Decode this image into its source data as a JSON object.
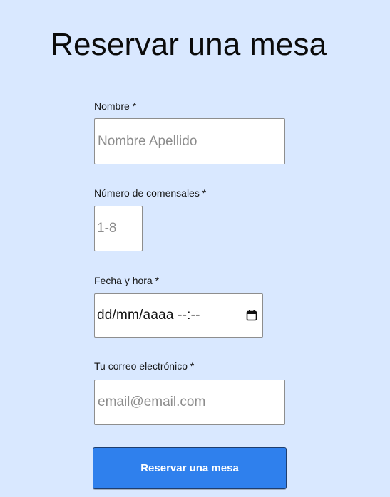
{
  "page": {
    "title": "Reservar una mesa"
  },
  "form": {
    "name": {
      "label": "Nombre *",
      "placeholder": "Nombre Apellido"
    },
    "guests": {
      "label": "Número de comensales *",
      "placeholder": "1-8"
    },
    "datetime": {
      "label": "Fecha y hora *",
      "display": "dd/mm/aaaa --:--",
      "icon": "calendar-icon"
    },
    "email": {
      "label": "Tu correo electrónico *",
      "placeholder": "email@email.com"
    },
    "submit_label": "Reservar una mesa"
  },
  "colors": {
    "background": "#d9e8ff",
    "button": "#2f80ed"
  }
}
